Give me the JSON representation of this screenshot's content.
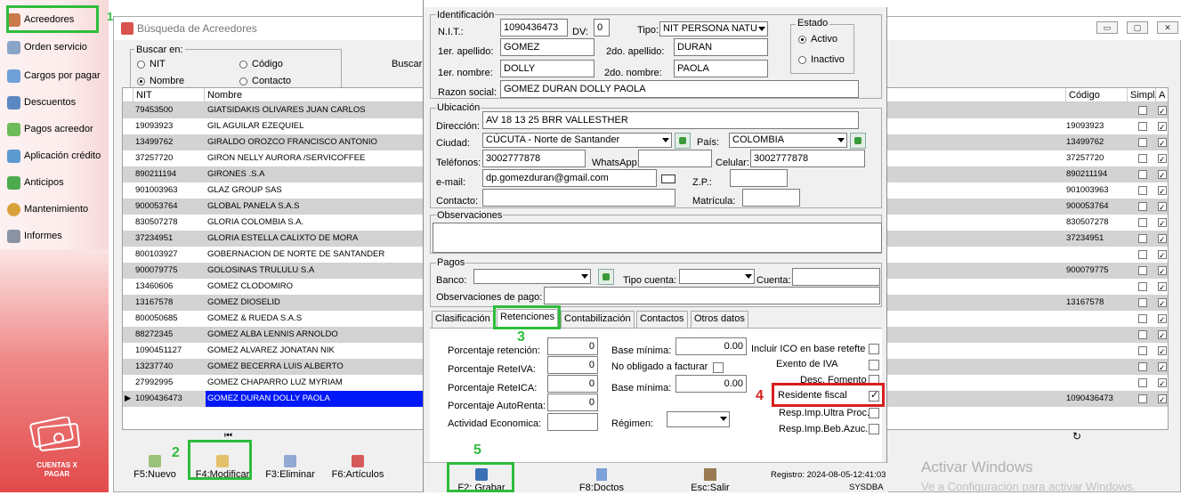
{
  "sidebar": {
    "items": [
      {
        "label": "Acreedores",
        "icon": "user-icon"
      },
      {
        "label": "Orden servicio",
        "icon": "order-icon"
      },
      {
        "label": "Cargos por pagar",
        "icon": "charges-icon"
      },
      {
        "label": "Descuentos",
        "icon": "discount-icon"
      },
      {
        "label": "Pagos acreedor",
        "icon": "payment-icon"
      },
      {
        "label": "Aplicación crédito",
        "icon": "credit-icon"
      },
      {
        "label": "Anticipos",
        "icon": "advance-icon"
      },
      {
        "label": "Mantenimiento",
        "icon": "gear-icon"
      },
      {
        "label": "Informes",
        "icon": "printer-icon"
      }
    ],
    "module_label": "CUENTAS X PAGAR"
  },
  "annotations": {
    "n1": "1",
    "n2": "2",
    "n3": "3",
    "n4": "4",
    "n5": "5"
  },
  "search_window": {
    "title": "Búsqueda de Acreedores",
    "buscar_en_label": "Buscar en:",
    "radios": {
      "nit": "NIT",
      "codigo": "Código",
      "nombre": "Nombre",
      "contacto": "Contacto"
    },
    "buscar_label": "Buscar",
    "columns": {
      "nit": "NIT",
      "nombre": "Nombre",
      "codigo": "Código",
      "simpl": "Simpl.",
      "a": "A"
    },
    "rows": [
      {
        "nit": "79453500",
        "nombre": "GIATSIDAKIS OLIVARES JUAN CARLOS",
        "codigo": "",
        "simpl": false,
        "a": true
      },
      {
        "nit": "19093923",
        "nombre": "GIL AGUILAR EZEQUIEL",
        "codigo": "19093923",
        "simpl": false,
        "a": true
      },
      {
        "nit": "13499762",
        "nombre": "GIRALDO OROZCO FRANCISCO ANTONIO",
        "codigo": "13499762",
        "simpl": false,
        "a": true
      },
      {
        "nit": "37257720",
        "nombre": "GIRON  NELLY AURORA /SERVICOFFEE",
        "codigo": "37257720",
        "simpl": false,
        "a": true
      },
      {
        "nit": "890211194",
        "nombre": "GIRONES .S.A",
        "codigo": "890211194",
        "simpl": false,
        "a": true
      },
      {
        "nit": "901003963",
        "nombre": "GLAZ GROUP SAS",
        "codigo": "901003963",
        "simpl": false,
        "a": true
      },
      {
        "nit": "900053764",
        "nombre": "GLOBAL PANELA S.A.S",
        "codigo": "900053764",
        "simpl": false,
        "a": true
      },
      {
        "nit": "830507278",
        "nombre": "GLORIA COLOMBIA S.A.",
        "codigo": "830507278",
        "simpl": false,
        "a": true
      },
      {
        "nit": "37234951",
        "nombre": "GLORIA ESTELLA CALIXTO DE MORA",
        "codigo": "37234951",
        "simpl": false,
        "a": true
      },
      {
        "nit": "800103927",
        "nombre": "GOBERNACION DE NORTE DE SANTANDER",
        "codigo": "",
        "simpl": false,
        "a": true
      },
      {
        "nit": "900079775",
        "nombre": "GOLOSINAS TRULULU S.A",
        "codigo": "900079775",
        "simpl": false,
        "a": true
      },
      {
        "nit": "13460606",
        "nombre": "GOMEZ  CLODOMIRO",
        "codigo": "",
        "simpl": false,
        "a": true
      },
      {
        "nit": "13167578",
        "nombre": "GOMEZ  DIOSELID",
        "codigo": "13167578",
        "simpl": false,
        "a": true
      },
      {
        "nit": "800050685",
        "nombre": "GOMEZ & RUEDA S.A.S",
        "codigo": "",
        "simpl": false,
        "a": true
      },
      {
        "nit": "88272345",
        "nombre": "GOMEZ ALBA LENNIS ARNOLDO",
        "codigo": "",
        "simpl": false,
        "a": true
      },
      {
        "nit": "1090451127",
        "nombre": "GOMEZ ALVAREZ JONATAN NIK",
        "codigo": "",
        "simpl": false,
        "a": true
      },
      {
        "nit": "13237740",
        "nombre": "GOMEZ BECERRA LUIS ALBERTO",
        "codigo": "",
        "simpl": false,
        "a": true
      },
      {
        "nit": "27992995",
        "nombre": "GOMEZ CHAPARRO LUZ MYRIAM",
        "codigo": "",
        "simpl": false,
        "a": true
      },
      {
        "nit": "1090436473",
        "nombre": "GOMEZ DURAN DOLLY PAOLA",
        "codigo": "1090436473",
        "simpl": false,
        "a": true
      }
    ],
    "toolbar": {
      "nuevo": "F5:Nuevo",
      "modificar": "F4:Modificar",
      "eliminar": "F3:Eliminar",
      "articulos": "F6:Artículos"
    }
  },
  "dialog": {
    "identificacion": {
      "legend": "Identificación",
      "nit_label": "N.I.T.:",
      "nit": "1090436473",
      "dv_label": "DV:",
      "dv": "0",
      "tipo_label": "Tipo:",
      "tipo": "NIT PERSONA NATU",
      "apellido1_label": "1er. apellido:",
      "apellido1": "GOMEZ",
      "apellido2_label": "2do. apellido:",
      "apellido2": "DURAN",
      "nombre1_label": "1er. nombre:",
      "nombre1": "DOLLY",
      "nombre2_label": "2do. nombre:",
      "nombre2": "PAOLA",
      "razon_label": "Razon social:",
      "razon": "GOMEZ DURAN DOLLY PAOLA",
      "estado_legend": "Estado",
      "activo": "Activo",
      "inactivo": "Inactivo"
    },
    "ubicacion": {
      "legend": "Ubicación",
      "direccion_label": "Dirección:",
      "direccion": "AV 18 13 25 BRR VALLESTHER",
      "ciudad_label": "Ciudad:",
      "ciudad": "CÚCUTA - Norte de Santander",
      "pais_label": "País:",
      "pais": "COLOMBIA",
      "telefonos_label": "Teléfonos:",
      "telefonos": "3002777878",
      "whatsapp_label": "WhatsApp:",
      "whatsapp": "",
      "celular_label": "Celular:",
      "celular": "3002777878",
      "email_label": "e-mail:",
      "email": "dp.gomezduran@gmail.com",
      "zp_label": "Z.P.:",
      "zp": "",
      "contacto_label": "Contacto:",
      "contacto": "",
      "matricula_label": "Matrícula:",
      "matricula": ""
    },
    "observaciones": {
      "legend": "Observaciones",
      "text": ""
    },
    "pagos": {
      "legend": "Pagos",
      "banco_label": "Banco:",
      "banco": "",
      "tipo_cuenta_label": "Tipo cuenta:",
      "tipo_cuenta": "",
      "cuenta_label": "Cuenta:",
      "cuenta": "",
      "obs_pago_label": "Observaciones de pago:",
      "obs_pago": ""
    },
    "tabs": [
      "Clasificación",
      "Retenciones",
      "Contabilización",
      "Contactos",
      "Otros datos"
    ],
    "retenciones": {
      "porcentaje_retencion_label": "Porcentaje retención:",
      "porcentaje_retencion": "0",
      "porcentaje_reteiva_label": "Porcentaje ReteIVA:",
      "porcentaje_reteiva": "0",
      "porcentaje_reteica_label": "Porcentaje ReteICA:",
      "porcentaje_reteica": "0",
      "porcentaje_autorenta_label": "Porcentaje AutoRenta:",
      "porcentaje_autorenta": "0",
      "actividad_label": "Actividad Economica:",
      "actividad": "",
      "base_minima1_label": "Base mínima:",
      "base_minima1": "0.00",
      "no_obligado_label": "No obligado a facturar",
      "base_minima2_label": "Base mínima:",
      "base_minima2": "0.00",
      "regimen_label": "Régimen:",
      "regimen": "",
      "ico_label": "Incluir ICO en base retefte",
      "exento_iva_label": "Exento de IVA",
      "desc_fomento_label": "Desc. Fomento",
      "residente_fiscal_label": "Residente fiscal",
      "resp_ultra_label": "Resp.Imp.Ultra Proc.",
      "resp_beb_label": "Resp.Imp.Beb.Azuc."
    },
    "footer": {
      "grabar": "F2: Grabar",
      "doctos": "F8:Doctos",
      "salir": "Esc:Salir",
      "registro": "Registro:  2024-08-05-12:41:03",
      "user": "SYSDBA"
    }
  },
  "watermark": {
    "line1": "Activar Windows",
    "line2": "Ve a Configuración para activar Windows."
  }
}
